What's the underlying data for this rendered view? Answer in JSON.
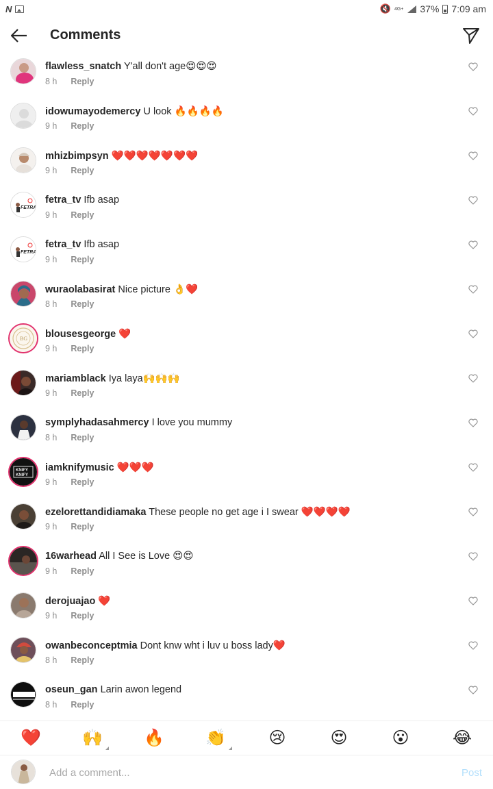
{
  "status_bar": {
    "network": "4G+",
    "battery": "37%",
    "time": "7:09 am"
  },
  "header": {
    "title": "Comments"
  },
  "comments": [
    {
      "username": "flawless_snatch",
      "text": "Y'all don't age😍😍😍",
      "time": "8 h",
      "reply": "Reply"
    },
    {
      "username": "idowumayodemercy",
      "text": "U look 🔥🔥🔥🔥",
      "time": "9 h",
      "reply": "Reply"
    },
    {
      "username": "mhizbimpsyn",
      "text": "❤️❤️❤️❤️❤️❤️❤️",
      "time": "9 h",
      "reply": "Reply"
    },
    {
      "username": "fetra_tv",
      "text": "Ifb asap",
      "time": "9 h",
      "reply": "Reply"
    },
    {
      "username": "fetra_tv",
      "text": "Ifb asap",
      "time": "9 h",
      "reply": "Reply"
    },
    {
      "username": "wuraolabasirat",
      "text": "Nice picture 👌❤️",
      "time": "8 h",
      "reply": "Reply"
    },
    {
      "username": "blousesgeorge",
      "text": "❤️",
      "time": "9 h",
      "reply": "Reply"
    },
    {
      "username": "mariamblack",
      "text": "Iya laya🙌🙌🙌",
      "time": "9 h",
      "reply": "Reply"
    },
    {
      "username": "symplyhadasahmercy",
      "text": "I love you mummy",
      "time": "8 h",
      "reply": "Reply"
    },
    {
      "username": "iamknifymusic",
      "text": "❤️❤️❤️",
      "time": "9 h",
      "reply": "Reply"
    },
    {
      "username": "ezelorettandidiamaka",
      "text": "These people no get age i I swear ❤️❤️❤️❤️",
      "time": "9 h",
      "reply": "Reply"
    },
    {
      "username": "16warhead",
      "text": "All I See is Love 😍😍",
      "time": "9 h",
      "reply": "Reply"
    },
    {
      "username": "derojuajao",
      "text": "❤️",
      "time": "9 h",
      "reply": "Reply"
    },
    {
      "username": "owanbeconceptmia",
      "text": "Dont knw wht i luv u boss lady❤️",
      "time": "8 h",
      "reply": "Reply"
    },
    {
      "username": "oseun_gan",
      "text": "Larin awon legend",
      "time": "8 h",
      "reply": "Reply"
    }
  ],
  "emoji_bar": [
    "❤️",
    "🙌",
    "🔥",
    "👏",
    "😢",
    "😍",
    "😮",
    "😂"
  ],
  "composer": {
    "placeholder": "Add a comment...",
    "post_label": "Post"
  },
  "colors": {
    "text": "#262626",
    "meta": "#8e8e8e",
    "post_disabled": "#b2dffc",
    "divider": "#efefef"
  }
}
